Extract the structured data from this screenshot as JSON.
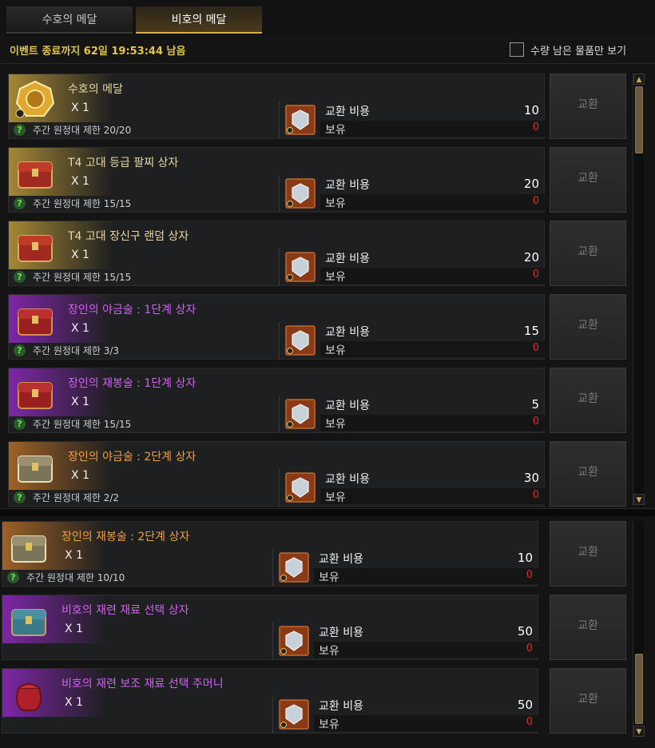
{
  "tabs": [
    {
      "label": "수호의 메달"
    },
    {
      "label": "비호의 메달"
    }
  ],
  "event": {
    "remaining": "이벤트 종료까지 62일 19:53:44 남음"
  },
  "filter": {
    "label": "수량 남은 물품만 보기"
  },
  "common": {
    "cost_label": "교환 비용",
    "own_label": "보유",
    "exchange_button": "교환",
    "limit_q": "?"
  },
  "items": [
    {
      "name": "수호의 메달",
      "qty": "X 1",
      "limit": "주간 원정대 제한 20/20",
      "cost": "10",
      "owned": "0",
      "grade": "gold"
    },
    {
      "name": "T4 고대 등급 팔찌 상자",
      "qty": "X 1",
      "limit": "주간 원정대 제한 15/15",
      "cost": "20",
      "owned": "0",
      "grade": "gold"
    },
    {
      "name": "T4 고대 장신구 랜덤 상자",
      "qty": "X 1",
      "limit": "주간 원정대 제한 15/15",
      "cost": "20",
      "owned": "0",
      "grade": "gold"
    },
    {
      "name": "장인의 야금술 : 1단계 상자",
      "qty": "X 1",
      "limit": "주간 원정대 제한 3/3",
      "cost": "15",
      "owned": "0",
      "grade": "purple"
    },
    {
      "name": "장인의 재봉술 : 1단계 상자",
      "qty": "X 1",
      "limit": "주간 원정대 제한 15/15",
      "cost": "5",
      "owned": "0",
      "grade": "purple"
    },
    {
      "name": "장인의 야금술 : 2단계 상자",
      "qty": "X 1",
      "limit": "주간 원정대 제한 2/2",
      "cost": "30",
      "owned": "0",
      "grade": "orange"
    },
    {
      "name": "장인의 재봉술 : 2단계 상자",
      "qty": "X 1",
      "limit": "주간 원정대 제한 10/10",
      "cost": "10",
      "owned": "0",
      "grade": "orange"
    },
    {
      "name": "비호의 재련 재료 선택 상자",
      "qty": "X 1",
      "limit": "",
      "cost": "50",
      "owned": "0",
      "grade": "purple"
    },
    {
      "name": "비호의 재련 보조 재료 선택 주머니",
      "qty": "X 1",
      "limit": "",
      "cost": "50",
      "owned": "0",
      "grade": "purple"
    }
  ]
}
